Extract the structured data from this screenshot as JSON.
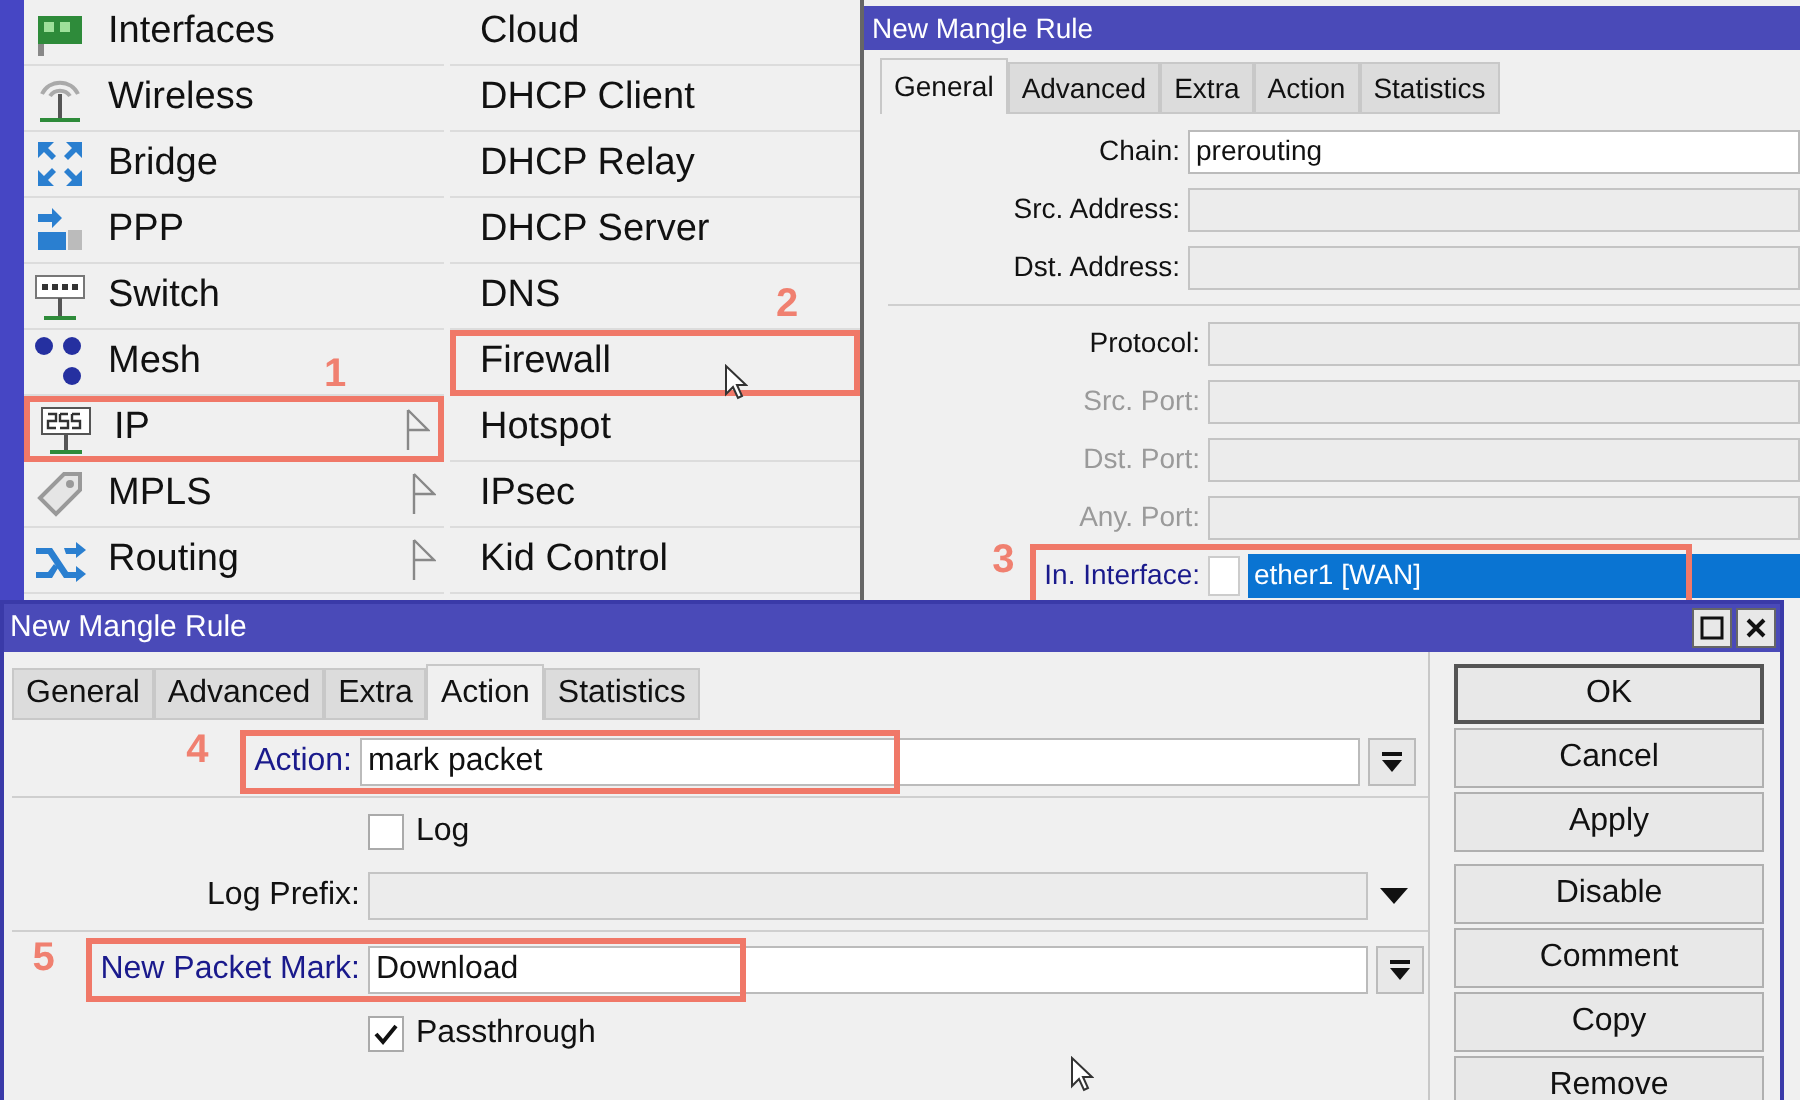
{
  "menu": {
    "items": [
      {
        "label": "Interfaces",
        "kind": "interfaces",
        "has_submenu": false
      },
      {
        "label": "Wireless",
        "kind": "wireless",
        "has_submenu": false
      },
      {
        "label": "Bridge",
        "kind": "bridge",
        "has_submenu": false
      },
      {
        "label": "PPP",
        "kind": "ppp",
        "has_submenu": false
      },
      {
        "label": "Switch",
        "kind": "switch",
        "has_submenu": false
      },
      {
        "label": "Mesh",
        "kind": "mesh",
        "has_submenu": false
      },
      {
        "label": "IP",
        "kind": "ip",
        "has_submenu": true,
        "callout": "1"
      },
      {
        "label": "MPLS",
        "kind": "mpls",
        "has_submenu": true
      },
      {
        "label": "Routing",
        "kind": "routing",
        "has_submenu": true
      }
    ]
  },
  "submenu": {
    "items": [
      {
        "label": "Cloud"
      },
      {
        "label": "DHCP Client"
      },
      {
        "label": "DHCP Relay"
      },
      {
        "label": "DHCP Server"
      },
      {
        "label": "DNS"
      },
      {
        "label": "Firewall",
        "callout": "2"
      },
      {
        "label": "Hotspot"
      },
      {
        "label": "IPsec"
      },
      {
        "label": "Kid Control"
      }
    ]
  },
  "back_window": {
    "title": "New Mangle Rule",
    "tabs": [
      {
        "label": "General",
        "selected": true
      },
      {
        "label": "Advanced",
        "selected": false
      },
      {
        "label": "Extra",
        "selected": false
      },
      {
        "label": "Action",
        "selected": false
      },
      {
        "label": "Statistics",
        "selected": false
      }
    ],
    "sections": [
      [
        {
          "label": "Chain:",
          "kind": "text",
          "value": "prerouting",
          "disabled": false,
          "set": false
        },
        {
          "label": "Src. Address:",
          "kind": "blank",
          "disabled": false,
          "set": false
        },
        {
          "label": "Dst. Address:",
          "kind": "blank",
          "disabled": false,
          "set": false
        }
      ],
      [
        {
          "label": "Protocol:",
          "kind": "blank",
          "disabled": false,
          "set": false
        },
        {
          "label": "Src. Port:",
          "kind": "blank",
          "disabled": true
        },
        {
          "label": "Dst. Port:",
          "kind": "blank",
          "disabled": true
        },
        {
          "label": "Any. Port:",
          "kind": "blank",
          "disabled": true
        },
        {
          "label": "In. Interface:",
          "kind": "interface",
          "value": "ether1 [WAN]",
          "checked": false,
          "disabled": false,
          "set": true,
          "callout": "3"
        }
      ]
    ]
  },
  "front_window": {
    "title": "New Mangle Rule",
    "tabs": [
      {
        "label": "General",
        "selected": false
      },
      {
        "label": "Advanced",
        "selected": false
      },
      {
        "label": "Extra",
        "selected": false
      },
      {
        "label": "Action",
        "selected": true
      },
      {
        "label": "Statistics",
        "selected": false
      }
    ],
    "sections": [
      [
        {
          "label": "Action:",
          "kind": "combo",
          "value": "mark packet",
          "set": true,
          "callout": "4"
        }
      ],
      [
        {
          "label": "Log",
          "kind": "checkbox",
          "checked": false
        },
        {
          "label": "Log Prefix:",
          "kind": "select",
          "set": false
        }
      ],
      [
        {
          "label": "New Packet Mark:",
          "kind": "combo",
          "value": "Download",
          "set": true,
          "callout": "5"
        },
        {
          "label": "Passthrough",
          "kind": "checkbox",
          "checked": true
        }
      ]
    ],
    "button_groups": [
      [
        {
          "label": "OK",
          "default": true
        },
        {
          "label": "Cancel",
          "default": false
        },
        {
          "label": "Apply",
          "default": false
        }
      ],
      [
        {
          "label": "Disable",
          "default": false
        },
        {
          "label": "Comment",
          "default": false
        },
        {
          "label": "Copy",
          "default": false
        },
        {
          "label": "Remove",
          "default": false
        }
      ]
    ]
  }
}
